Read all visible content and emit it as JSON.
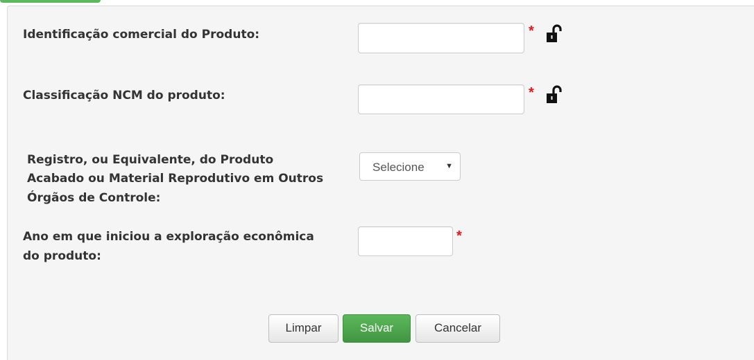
{
  "form": {
    "identificacao_label": "Identificação comercial do Produto:",
    "identificacao_value": "",
    "ncm_label": "Classificação NCM do produto:",
    "ncm_value": "",
    "registro_label_line1": "Registro, ou Equivalente, do Produto",
    "registro_label_line2": "Acabado ou Material Reprodutivo em Outros",
    "registro_label_line3": "Órgãos de Controle:",
    "registro_select_value": "Selecione",
    "ano_label_line1": "Ano em que iniciou a exploração econômica",
    "ano_label_line2": "do produto:",
    "ano_value": "",
    "required_marker": "*"
  },
  "buttons": {
    "limpar": "Limpar",
    "salvar": "Salvar",
    "cancelar": "Cancelar"
  },
  "icons": {
    "lock": "unlocked-padlock-icon",
    "select_arrow": "caret-down-icon"
  },
  "colors": {
    "required": "#e8161d",
    "success": "#5cb85c",
    "panel_bg": "#f5f5f5"
  }
}
